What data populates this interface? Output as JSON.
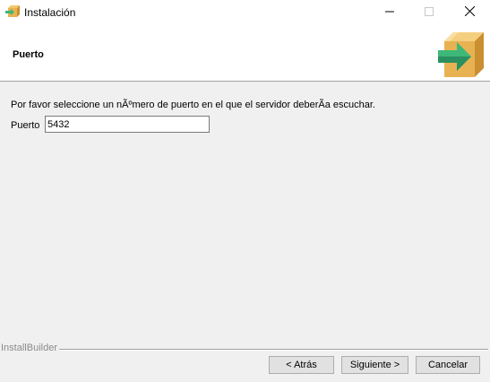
{
  "window": {
    "title": "Instalación",
    "controls": {
      "minimize_icon": "minimize-icon",
      "maximize_icon": "maximize-icon",
      "close_icon": "close-icon"
    }
  },
  "header": {
    "title": "Puerto",
    "logo_icon": "installer-box-arrow-icon"
  },
  "content": {
    "description": "Por favor seleccione un nÃºmero de puerto en el que el servidor deberÃa escuchar.",
    "port_label": "Puerto",
    "port_value": "5432"
  },
  "footer": {
    "brand_label": "InstallBuilder",
    "back_label": "< Atrás",
    "next_label": "Siguiente >",
    "cancel_label": "Cancelar"
  },
  "colors": {
    "box": "#e8b252",
    "box_dark": "#c98f30",
    "arrow": "#3cb878",
    "arrow_dark": "#2a9060"
  }
}
